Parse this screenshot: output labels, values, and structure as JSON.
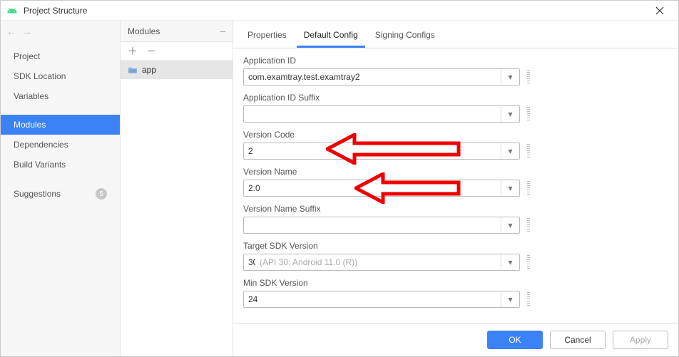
{
  "window": {
    "title": "Project Structure"
  },
  "sidebar": {
    "items": [
      {
        "label": "Project"
      },
      {
        "label": "SDK Location"
      },
      {
        "label": "Variables"
      },
      {
        "label": "Modules",
        "selected": true
      },
      {
        "label": "Dependencies"
      },
      {
        "label": "Build Variants"
      },
      {
        "label": "Suggestions",
        "badge": "5"
      }
    ]
  },
  "modules": {
    "header": "Modules",
    "items": [
      {
        "label": "app"
      }
    ]
  },
  "tabs": [
    {
      "label": "Properties"
    },
    {
      "label": "Default Config",
      "active": true
    },
    {
      "label": "Signing Configs"
    }
  ],
  "form": {
    "applicationId": {
      "label": "Application ID",
      "value": "com.examtray.test.examtray2"
    },
    "applicationIdSuffix": {
      "label": "Application ID Suffix",
      "value": ""
    },
    "versionCode": {
      "label": "Version Code",
      "value": "2"
    },
    "versionName": {
      "label": "Version Name",
      "value": "2.0"
    },
    "versionNameSuffix": {
      "label": "Version Name Suffix",
      "value": ""
    },
    "targetSdk": {
      "label": "Target SDK Version",
      "value": "30",
      "hint": "(API 30: Android 11.0 (R))"
    },
    "minSdk": {
      "label": "Min SDK Version",
      "value": "24"
    }
  },
  "footer": {
    "ok": "OK",
    "cancel": "Cancel",
    "apply": "Apply"
  }
}
